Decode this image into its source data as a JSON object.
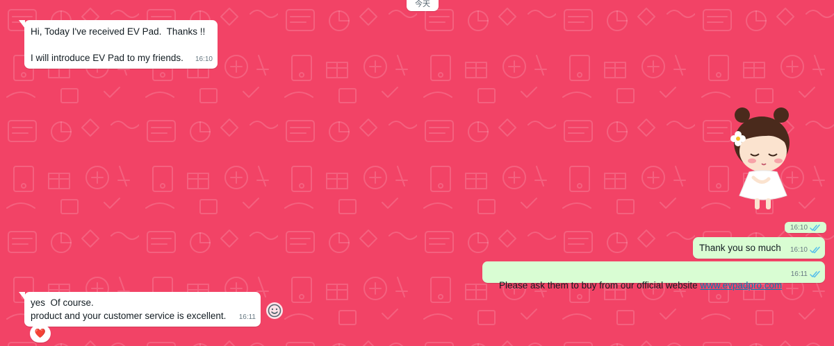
{
  "chat": {
    "date_divider": "今天",
    "messages": [
      {
        "direction": "incoming",
        "text": "Hi, Today I've received EV Pad.  Thanks !!\n\nI will introduce EV Pad to my friends.",
        "time": "16:10"
      },
      {
        "direction": "outgoing",
        "type": "sticker",
        "sticker_icon": "girl-with-flower-sticker",
        "time": "16:10",
        "status": "read"
      },
      {
        "direction": "outgoing",
        "text": "Thank you so much",
        "time": "16:10",
        "status": "read"
      },
      {
        "direction": "outgoing",
        "text_before_link": "Please ask them to buy from our official website ",
        "link": "www.evpadpro.com",
        "time": "16:11",
        "status": "read"
      },
      {
        "direction": "incoming",
        "text": "yes  Of course.\nproduct and your customer service is excellent.",
        "time": "16:11",
        "reaction": "❤️"
      }
    ]
  },
  "icons": {
    "read_receipt": "double-check-icon",
    "reaction_button": "smiley-icon",
    "reaction": "heart-icon"
  },
  "colors": {
    "wallpaper": "#f24366",
    "incoming_bubble": "#ffffff",
    "outgoing_bubble": "#d9fdd3",
    "read_tick": "#53bdeb",
    "link": "#027eb5"
  }
}
